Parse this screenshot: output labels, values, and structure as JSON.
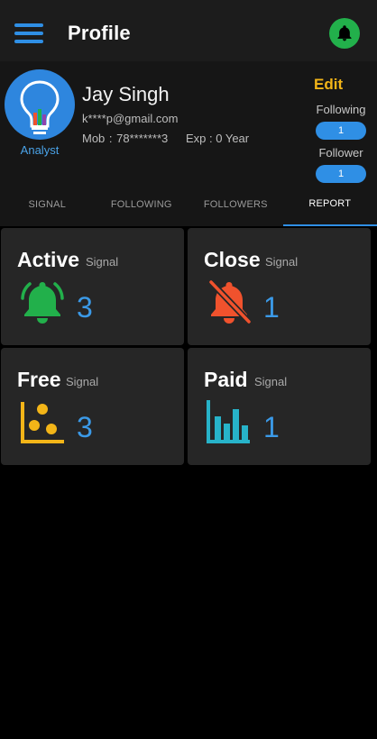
{
  "appbar": {
    "title": "Profile",
    "menu_icon": "hamburger-menu-icon",
    "notification_icon": "bell-icon"
  },
  "profile": {
    "role": "Analyst",
    "name": "Jay Singh",
    "email": "k****p@gmail.com",
    "mobile": "Mob : 78*******3",
    "experience": "Exp : 0 Year",
    "edit_label": "Edit",
    "following_label": "Following",
    "following_count": "1",
    "follower_label": "Follower",
    "follower_count": "1"
  },
  "tabs": [
    {
      "label": "SIGNAL",
      "active": false
    },
    {
      "label": "FOLLOWING",
      "active": false
    },
    {
      "label": "FOLLOWERS",
      "active": false
    },
    {
      "label": "REPORT",
      "active": true
    }
  ],
  "cards": [
    {
      "title": "Active",
      "subtitle": "Signal",
      "count": "3",
      "icon": "ringing-bell-icon",
      "icon_color": "#22b04b"
    },
    {
      "title": "Close",
      "subtitle": "Signal",
      "count": "1",
      "icon": "bell-off-icon",
      "icon_color": "#f0522d"
    },
    {
      "title": "Free",
      "subtitle": "Signal",
      "count": "3",
      "icon": "scatter-chart-icon",
      "icon_color": "#f3b518"
    },
    {
      "title": "Paid",
      "subtitle": "Signal",
      "count": "1",
      "icon": "bar-chart-icon",
      "icon_color": "#27b3c9"
    }
  ],
  "colors": {
    "accent": "#2f8fe5",
    "edit": "#f3b518",
    "count": "#3b9ae8"
  }
}
